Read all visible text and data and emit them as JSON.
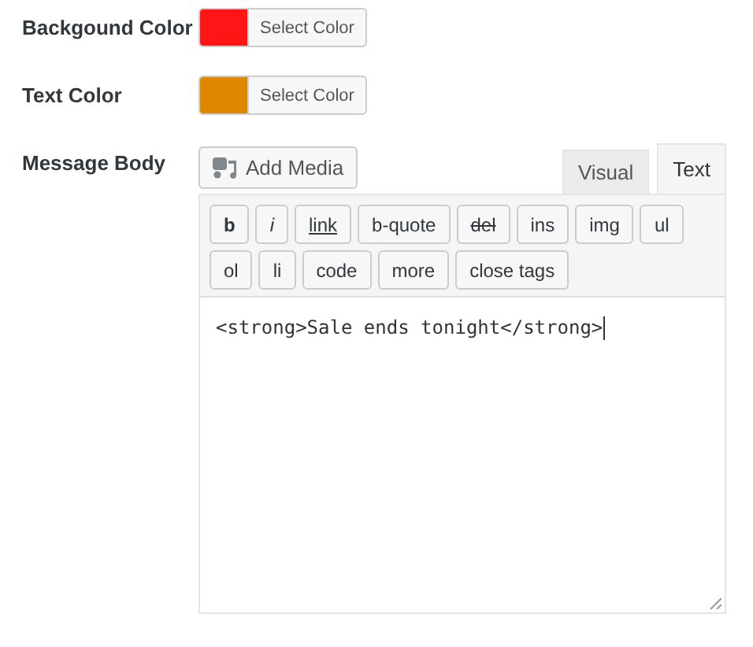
{
  "fields": [
    {
      "label": "Backgound Color",
      "color": "#ff1515",
      "button": "Select Color"
    },
    {
      "label": "Text Color",
      "color": "#de8800",
      "button": "Select Color"
    }
  ],
  "message_body": {
    "label": "Message Body",
    "add_media": "Add Media",
    "tabs": [
      {
        "label": "Visual",
        "selected": false
      },
      {
        "label": "Text",
        "selected": true
      }
    ],
    "quicktags": [
      {
        "label": "b",
        "kind": "bold"
      },
      {
        "label": "i",
        "kind": "italic"
      },
      {
        "label": "link",
        "kind": "underline"
      },
      {
        "label": "b-quote",
        "kind": "plain"
      },
      {
        "label": "del",
        "kind": "strike"
      },
      {
        "label": "ins",
        "kind": "plain"
      },
      {
        "label": "img",
        "kind": "plain"
      },
      {
        "label": "ul",
        "kind": "plain"
      },
      {
        "label": "ol",
        "kind": "plain"
      },
      {
        "label": "li",
        "kind": "plain"
      },
      {
        "label": "code",
        "kind": "plain"
      },
      {
        "label": "more",
        "kind": "plain"
      },
      {
        "label": "close tags",
        "kind": "plain"
      }
    ],
    "value": "<strong>Sale ends tonight</strong>"
  }
}
